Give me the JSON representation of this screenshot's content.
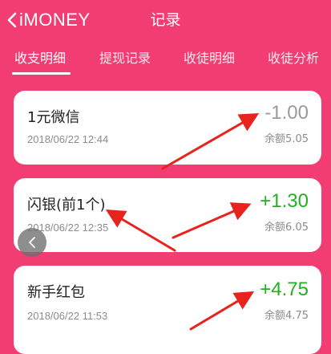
{
  "header": {
    "brand": "iMONEY",
    "title": "记录"
  },
  "tabs": [
    {
      "label": "收支明细",
      "active": true
    },
    {
      "label": "提现记录",
      "active": false
    },
    {
      "label": "收徒明细",
      "active": false
    },
    {
      "label": "收徒分析",
      "active": false
    }
  ],
  "records": [
    {
      "name": "1元微信",
      "amount": "-1.00",
      "date": "2018/06/22 12:44",
      "balance_label": "余额",
      "balance": "5.05",
      "amount_color": "#9a9a9a"
    },
    {
      "name": "闪银(前1个)",
      "amount": "+1.30",
      "date": "2018/06/22 12:35",
      "balance_label": "余额",
      "balance": "6.05",
      "amount_color": "#20b020"
    },
    {
      "name": "新手红包",
      "amount": "+4.75",
      "date": "2018/06/22 11:53",
      "balance_label": "余额",
      "balance": "4.75",
      "amount_color": "#20b020"
    }
  ],
  "colors": {
    "background": "#f23d73",
    "positive": "#20b020",
    "negative": "#9a9a9a",
    "annotation_arrow": "#e8231e"
  },
  "icons": {
    "back": "chevron-left-icon",
    "floating_back": "chevron-left-icon"
  }
}
